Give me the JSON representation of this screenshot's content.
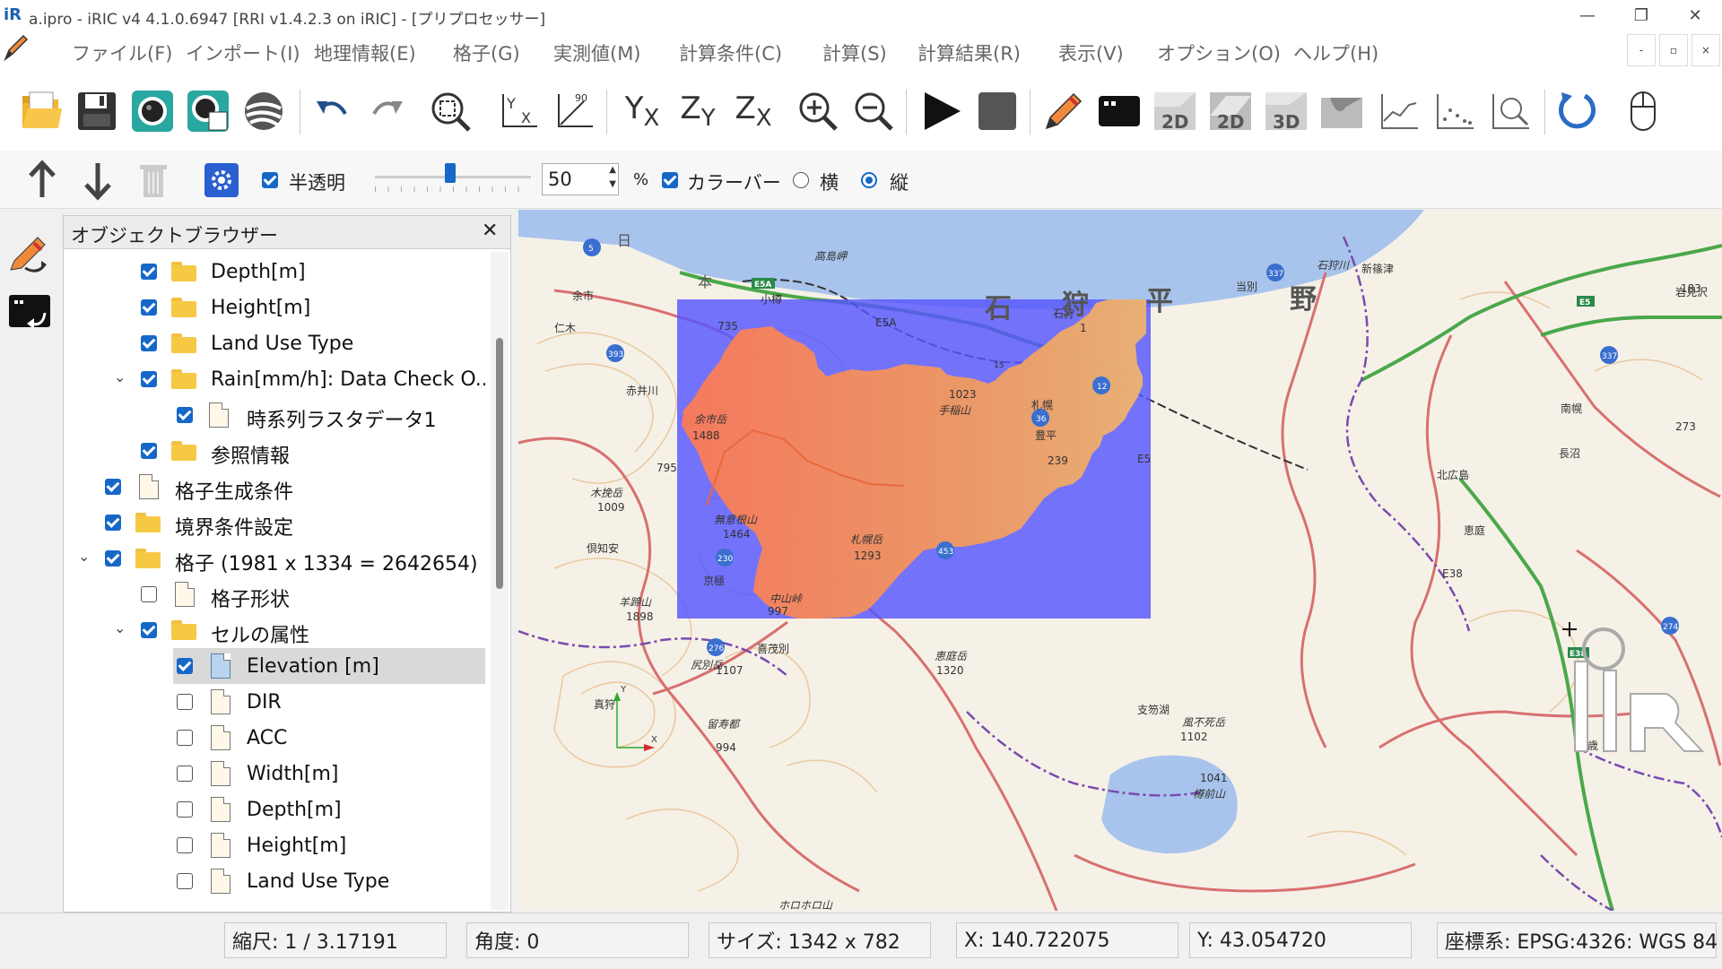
{
  "window": {
    "title": "a.ipro - iRIC v4 4.1.0.6947 [RRI v1.4.2.3 on iRIC] - [プリプロセッサー]",
    "app_icon": "iR",
    "controls": [
      "—",
      "❐",
      "✕"
    ]
  },
  "menu": [
    "ファイル(F)",
    "インポート(I)",
    "地理情報(E)",
    "格子(G)",
    "実測値(M)",
    "計算条件(C)",
    "計算(S)",
    "計算結果(R)",
    "表示(V)",
    "オプション(O)",
    "ヘルプ(H)"
  ],
  "mdi_controls": [
    "-",
    "▫",
    "×"
  ],
  "toolbar": {
    "buttons": [
      "open-folder-icon",
      "save-icon",
      "camera-icon",
      "snapshot-icon",
      "globe-icon",
      "undo-icon",
      "redo-icon",
      "fit-icon",
      "axis-yx-icon",
      "axis-rotate-icon",
      "view-yx-icon",
      "view-zy-icon",
      "view-zx-icon",
      "zoom-in-icon",
      "zoom-out-icon",
      "run-icon",
      "stop-icon",
      "pencil-icon",
      "console-icon",
      "2d-icon",
      "2d-alt-icon",
      "3d-icon",
      "profile-icon",
      "graph-icon",
      "scatter-icon",
      "graph-zoom-icon",
      "refresh-icon",
      "mouse-icon"
    ],
    "labels": {
      "2d": "2D",
      "2d_alt": "2D",
      "3d": "3D",
      "axis_y": "Y",
      "axis_x": "X",
      "axis_90": "90"
    }
  },
  "toolbar2": {
    "translucent_label": "半透明",
    "translucent_checked": true,
    "opacity_value": "50",
    "percent_sign": "%",
    "colorbar_label": "カラーバー",
    "colorbar_checked": true,
    "horizontal_label": "横",
    "vertical_label": "縦",
    "orientation": "vertical",
    "slider_position": 0.5
  },
  "object_browser": {
    "title": "オブジェクトブラウザー",
    "close": "✕",
    "items": [
      {
        "label": "Depth[m]",
        "checked": true,
        "icon": "folder"
      },
      {
        "label": "Height[m]",
        "checked": true,
        "icon": "folder"
      },
      {
        "label": "Land Use Type",
        "checked": true,
        "icon": "folder"
      },
      {
        "label": "Rain[mm/h]: Data Check O...",
        "checked": true,
        "icon": "folder",
        "expanded": true
      },
      {
        "label": "時系列ラスタデータ1",
        "checked": true,
        "icon": "doc"
      },
      {
        "label": "参照情報",
        "checked": true,
        "icon": "folder"
      },
      {
        "label": "格子生成条件",
        "checked": true,
        "icon": "doc"
      },
      {
        "label": "境界条件設定",
        "checked": true,
        "icon": "folder"
      },
      {
        "label": "格子 (1981 x 1334 = 2642654)",
        "checked": true,
        "icon": "folder",
        "expanded": true
      },
      {
        "label": "格子形状",
        "checked": false,
        "icon": "doc"
      },
      {
        "label": "セルの属性",
        "checked": true,
        "icon": "folder",
        "expanded": true
      },
      {
        "label": "Elevation [m]",
        "checked": true,
        "icon": "doc-blue",
        "selected": true
      },
      {
        "label": "DIR",
        "checked": false,
        "icon": "doc"
      },
      {
        "label": "ACC",
        "checked": false,
        "icon": "doc"
      },
      {
        "label": "Width[m]",
        "checked": false,
        "icon": "doc"
      },
      {
        "label": "Depth[m]",
        "checked": false,
        "icon": "doc"
      },
      {
        "label": "Height[m]",
        "checked": false,
        "icon": "doc"
      },
      {
        "label": "Land Use Type",
        "checked": false,
        "icon": "doc"
      }
    ]
  },
  "map": {
    "place_labels": [
      "石狩川",
      "高島岬",
      "余市",
      "小樽",
      "石狩",
      "当別",
      "新篠津",
      "岩見沢",
      "仁木",
      "735",
      "赤井川",
      "余市岳",
      "1488",
      "1023",
      "手稲山",
      "札幌",
      "豊平",
      "南幌",
      "長沼",
      "北広島",
      "795",
      "木挽岳",
      "1009",
      "倶知安",
      "無意根山",
      "1464",
      "札幌岳",
      "1293",
      "中山峠",
      "997",
      "羊蹄山",
      "1898",
      "京極",
      "喜茂別",
      "尻別岳",
      "1107",
      "恵庭岳",
      "1320",
      "真狩",
      "留寿都",
      "994",
      "支笏湖",
      "風不死岳",
      "1102",
      "1041",
      "樽前山",
      "千歳",
      "恵庭",
      "ホロホロ山",
      "E5A",
      "E5",
      "E38",
      "石",
      "狩",
      "平",
      "野",
      "日",
      "本",
      "273",
      "183",
      "239",
      "1"
    ],
    "road_numbers": [
      "5",
      "337",
      "393",
      "230",
      "453",
      "36",
      "12",
      "274",
      "276",
      "337",
      "15"
    ],
    "colors": {
      "sea": "#a8c4ec",
      "lake": "#a8c4ec",
      "overlay_blue": "#5555ff",
      "overlay_orange_low": "#f0a860",
      "overlay_orange_high": "#ff7a50",
      "road_red": "#d87070",
      "road_green": "#4aa84a",
      "contour": "#e9c9a0"
    },
    "axis_labels": {
      "y": "Y",
      "x": "X"
    },
    "logo": "iRIC"
  },
  "status": {
    "scale": "縮尺: 1 / 3.17191",
    "angle": "角度: 0",
    "size": "サイズ: 1342 x 782",
    "x": "X: 140.722075",
    "y": "Y: 43.054720",
    "crs": "座標系: EPSG:4326: WGS 84"
  }
}
